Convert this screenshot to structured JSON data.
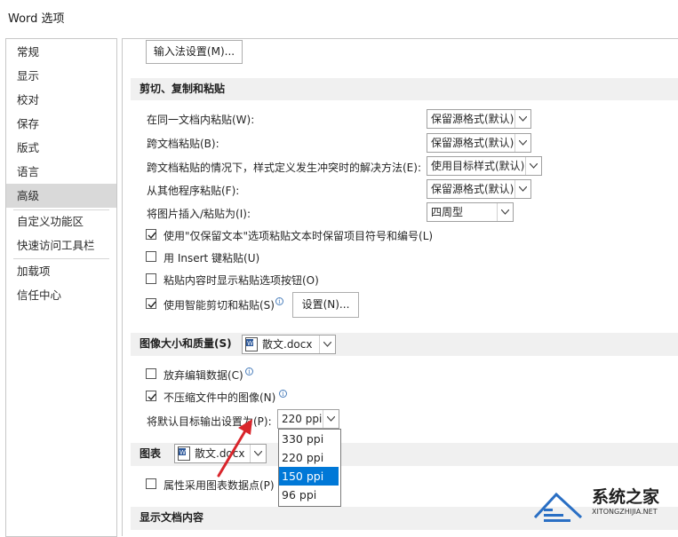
{
  "window": {
    "title": "Word 选项"
  },
  "sidebar": {
    "items": [
      {
        "label": "常规"
      },
      {
        "label": "显示"
      },
      {
        "label": "校对"
      },
      {
        "label": "保存"
      },
      {
        "label": "版式"
      },
      {
        "label": "语言"
      },
      {
        "label": "高级"
      },
      {
        "label": "自定义功能区"
      },
      {
        "label": "快速访问工具栏"
      },
      {
        "label": "加载项"
      },
      {
        "label": "信任中心"
      }
    ],
    "selected": "高级"
  },
  "top_button": {
    "label": "输入法设置(M)..."
  },
  "cut_copy_paste": {
    "header": "剪切、复制和粘贴",
    "rows": [
      {
        "label": "在同一文档内粘贴(W):",
        "value": "保留源格式(默认)"
      },
      {
        "label": "跨文档粘贴(B):",
        "value": "保留源格式(默认)"
      },
      {
        "label": "跨文档粘贴的情况下，样式定义发生冲突时的解决方法(E):",
        "value": "使用目标样式(默认)"
      },
      {
        "label": "从其他程序粘贴(F):",
        "value": "保留源格式(默认)"
      },
      {
        "label": "将图片插入/粘贴为(I):",
        "value": "四周型"
      }
    ],
    "checks": [
      {
        "label": "使用\"仅保留文本\"选项粘贴文本时保留项目符号和编号(L)",
        "checked": true
      },
      {
        "label": "用 Insert 键粘贴(U)",
        "checked": false
      },
      {
        "label": "粘贴内容时显示粘贴选项按钮(O)",
        "checked": false
      },
      {
        "label": "使用智能剪切和粘贴(S)",
        "checked": true
      }
    ],
    "settings_button": "设置(N)..."
  },
  "image_quality": {
    "header": "图像大小和质量(S)",
    "document": "散文.docx",
    "checks": [
      {
        "label": "放弃编辑数据(C)",
        "checked": false
      },
      {
        "label": "不压缩文件中的图像(N)",
        "checked": true
      }
    ],
    "default_res_label": "将默认目标输出设置为(P):",
    "default_res_value": "220 ppi",
    "options": [
      "330 ppi",
      "220 ppi",
      "150 ppi",
      "96 ppi"
    ],
    "highlighted_option": "150 ppi"
  },
  "chart": {
    "header": "图表",
    "document": "散文.docx",
    "checks": [
      {
        "label": "属性采用图表数据点(P)",
        "checked": false
      }
    ]
  },
  "show_doc": {
    "header": "显示文档内容"
  },
  "watermark": {
    "name": "系统之家",
    "url": "XITONGZHIJIA.NET"
  },
  "colors": {
    "accent": "#0078d7",
    "arrow": "#d9252b",
    "selected_nav": "#d9d9d9"
  }
}
